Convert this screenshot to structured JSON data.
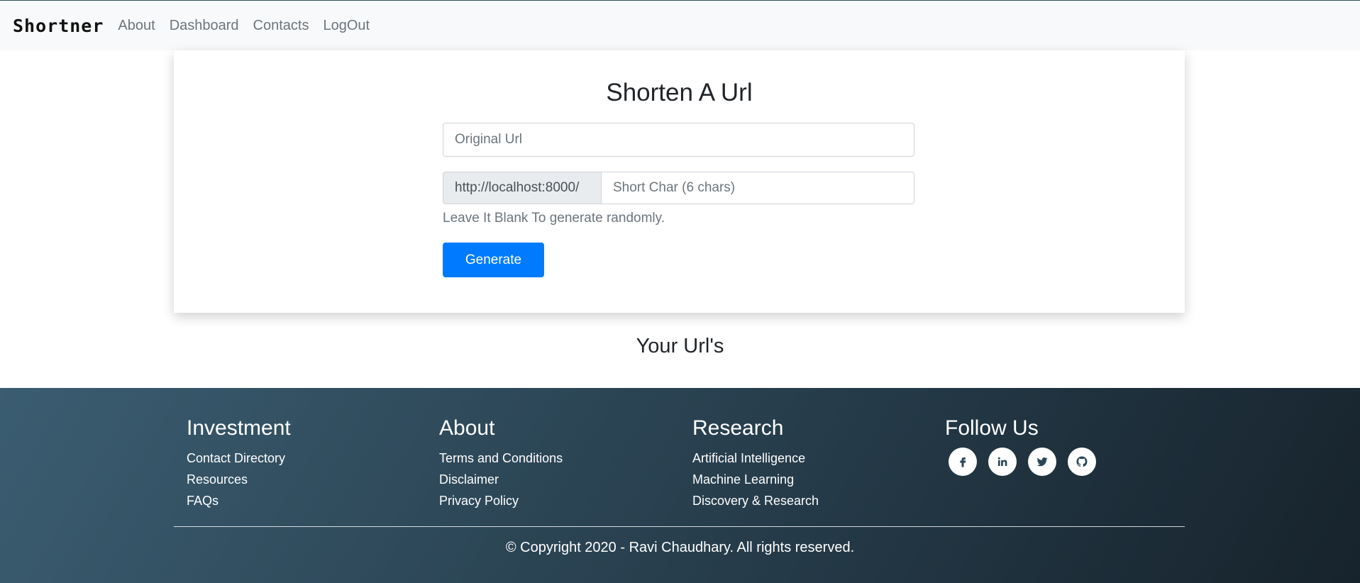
{
  "navbar": {
    "brand": "Shortner",
    "links": [
      {
        "label": "About"
      },
      {
        "label": "Dashboard"
      },
      {
        "label": "Contacts"
      },
      {
        "label": "LogOut"
      }
    ]
  },
  "form": {
    "title": "Shorten A Url",
    "original_placeholder": "Original Url",
    "prefix": "http://localhost:8000/",
    "short_placeholder": "Short Char (6 chars)",
    "help_text": "Leave It Blank To generate randomly.",
    "generate_label": "Generate"
  },
  "urls_heading": "Your Url's",
  "footer": {
    "columns": [
      {
        "title": "Investment",
        "links": [
          "Contact Directory",
          "Resources",
          "FAQs"
        ]
      },
      {
        "title": "About",
        "links": [
          "Terms and Conditions",
          "Disclaimer",
          "Privacy Policy"
        ]
      },
      {
        "title": "Research",
        "links": [
          "Artificial Intelligence",
          "Machine Learning",
          "Discovery & Research"
        ]
      }
    ],
    "follow_title": "Follow Us",
    "social_icons": [
      "facebook-icon",
      "linkedin-icon",
      "twitter-icon",
      "github-icon"
    ],
    "copyright": "© Copyright 2020 - Ravi Chaudhary. All rights reserved."
  }
}
